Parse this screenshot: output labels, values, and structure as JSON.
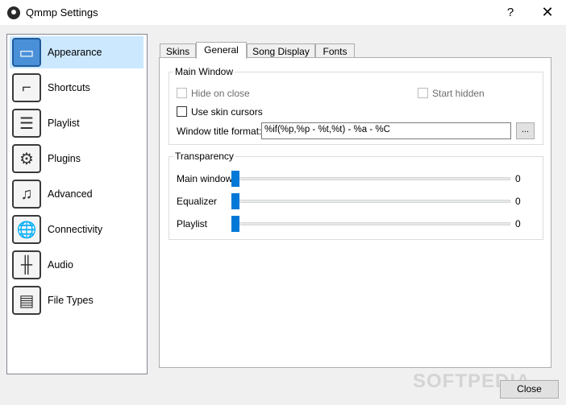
{
  "window": {
    "title": "Qmmp Settings",
    "help_label": "?",
    "close_label": "✕"
  },
  "sidebar": {
    "items": [
      {
        "label": "Appearance",
        "icon": "appearance-icon",
        "selected": true
      },
      {
        "label": "Shortcuts",
        "icon": "shortcuts-icon"
      },
      {
        "label": "Playlist",
        "icon": "playlist-icon"
      },
      {
        "label": "Plugins",
        "icon": "plugins-icon"
      },
      {
        "label": "Advanced",
        "icon": "advanced-icon"
      },
      {
        "label": "Connectivity",
        "icon": "connectivity-icon"
      },
      {
        "label": "Audio",
        "icon": "audio-icon"
      },
      {
        "label": "File Types",
        "icon": "file-types-icon"
      }
    ]
  },
  "tabs": [
    {
      "label": "Skins"
    },
    {
      "label": "General",
      "active": true
    },
    {
      "label": "Song Display"
    },
    {
      "label": "Fonts"
    }
  ],
  "main_window": {
    "title": "Main Window",
    "hide_on_close": {
      "label": "Hide on close",
      "checked": false,
      "enabled": false
    },
    "start_hidden": {
      "label": "Start hidden",
      "checked": false,
      "enabled": false
    },
    "use_skin_cursors": {
      "label": "Use skin cursors",
      "checked": false,
      "enabled": true
    },
    "window_title_format": {
      "label": "Window title format:",
      "value": "%if(%p,%p - %t,%t) - %a - %C"
    },
    "format_button": "..."
  },
  "transparency": {
    "title": "Transparency",
    "sliders": [
      {
        "label": "Main window",
        "value": "0"
      },
      {
        "label": "Equalizer",
        "value": "0"
      },
      {
        "label": "Playlist",
        "value": "0"
      }
    ]
  },
  "footer": {
    "close_label": "Close",
    "watermark": "SOFTPEDIA"
  },
  "colors": {
    "selection": "#cce8ff",
    "accent": "#0078d7"
  }
}
